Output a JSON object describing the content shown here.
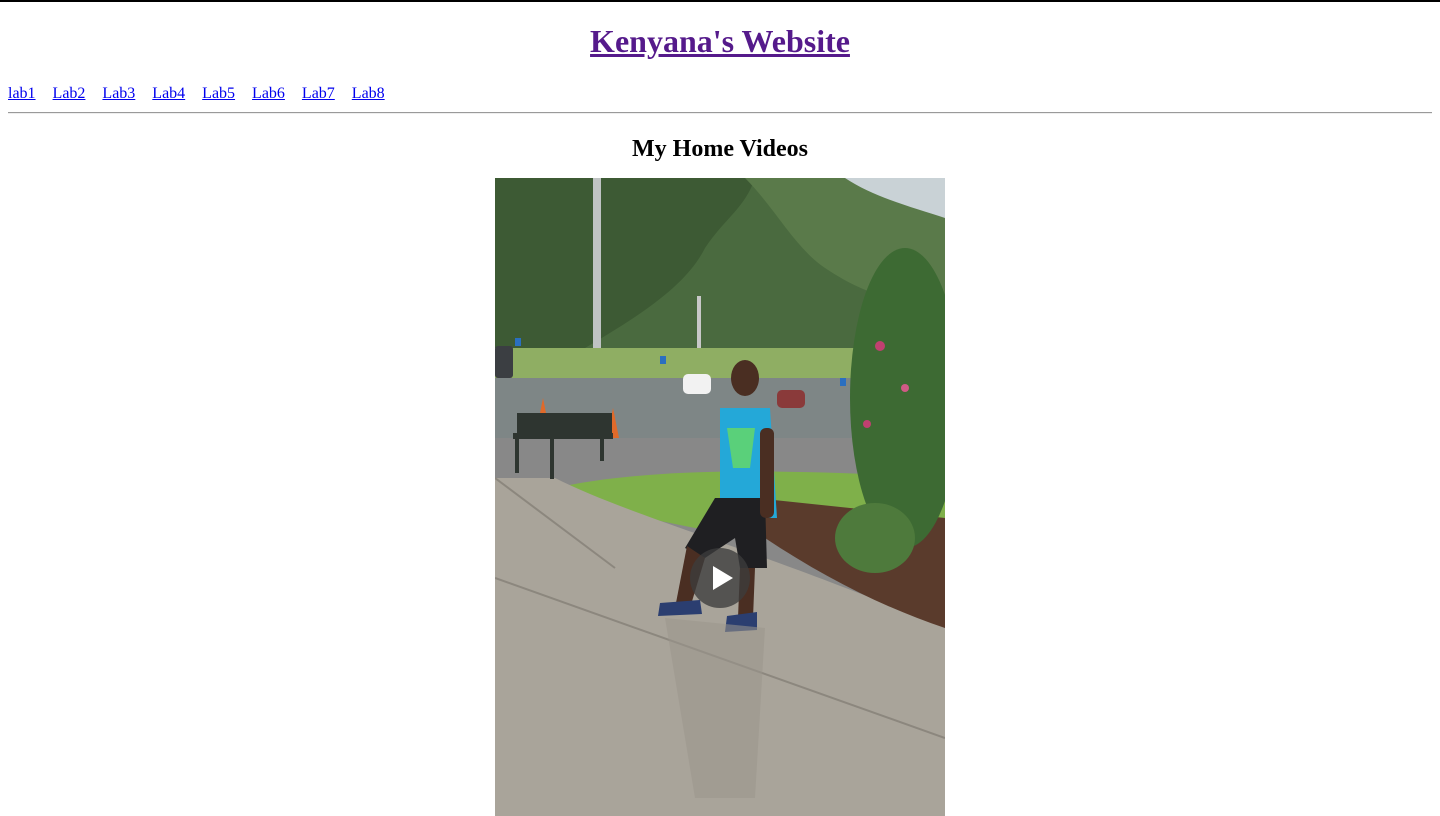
{
  "site": {
    "title": "Kenyana's Website"
  },
  "nav": {
    "links": [
      "lab1",
      "Lab2",
      "Lab3",
      "Lab4",
      "Lab5",
      "Lab6",
      "Lab7",
      "Lab8"
    ]
  },
  "main": {
    "section_title": "My Home Videos"
  },
  "video": {
    "state": "paused",
    "play_icon": "play-icon"
  },
  "colors": {
    "visited_link": "#551a8b",
    "link": "#0000ee"
  }
}
